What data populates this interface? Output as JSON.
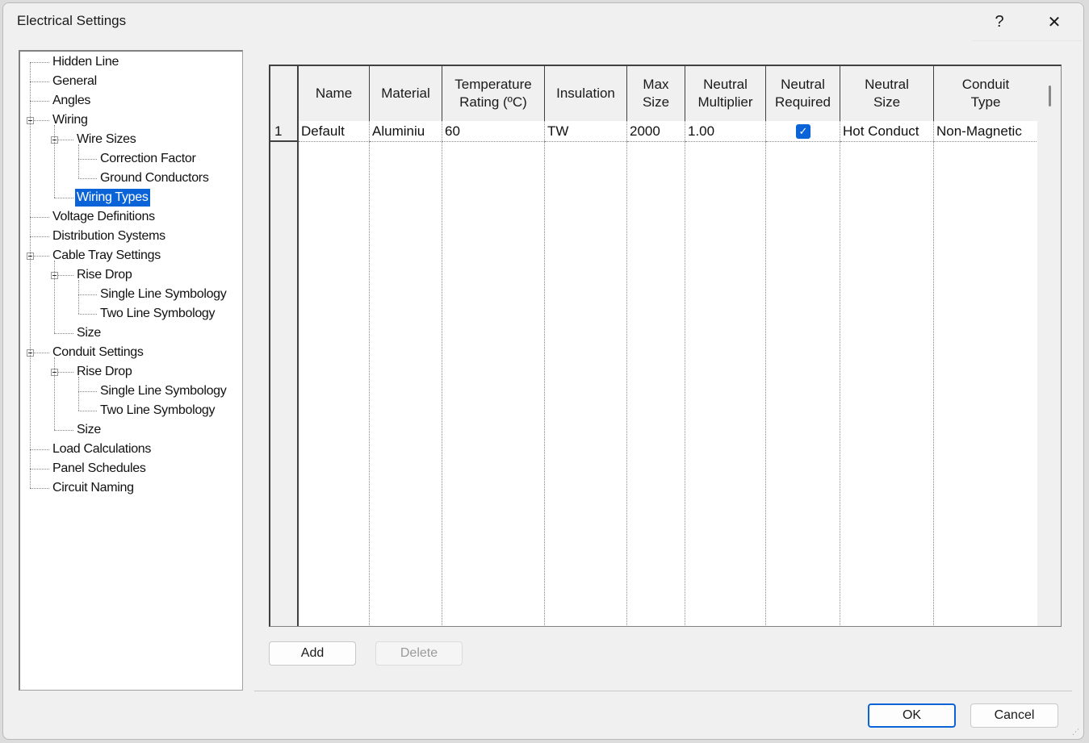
{
  "window": {
    "title": "Electrical Settings",
    "help_label": "?",
    "close_label": "✕"
  },
  "tree": {
    "items": [
      {
        "label": "Hidden Line",
        "level": 0,
        "expandable": false
      },
      {
        "label": "General",
        "level": 0,
        "expandable": false
      },
      {
        "label": "Angles",
        "level": 0,
        "expandable": false
      },
      {
        "label": "Wiring",
        "level": 0,
        "expandable": true
      },
      {
        "label": "Wire Sizes",
        "level": 1,
        "expandable": true
      },
      {
        "label": "Correction Factor",
        "level": 2,
        "expandable": false
      },
      {
        "label": "Ground Conductors",
        "level": 2,
        "expandable": false
      },
      {
        "label": "Wiring Types",
        "level": 1,
        "expandable": false,
        "selected": true
      },
      {
        "label": "Voltage Definitions",
        "level": 0,
        "expandable": false
      },
      {
        "label": "Distribution Systems",
        "level": 0,
        "expandable": false
      },
      {
        "label": "Cable Tray Settings",
        "level": 0,
        "expandable": true
      },
      {
        "label": "Rise Drop",
        "level": 1,
        "expandable": true
      },
      {
        "label": "Single Line Symbology",
        "level": 2,
        "expandable": false
      },
      {
        "label": "Two Line Symbology",
        "level": 2,
        "expandable": false
      },
      {
        "label": "Size",
        "level": 1,
        "expandable": false
      },
      {
        "label": "Conduit Settings",
        "level": 0,
        "expandable": true
      },
      {
        "label": "Rise Drop",
        "level": 1,
        "expandable": true
      },
      {
        "label": "Single Line Symbology",
        "level": 2,
        "expandable": false
      },
      {
        "label": "Two Line Symbology",
        "level": 2,
        "expandable": false
      },
      {
        "label": "Size",
        "level": 1,
        "expandable": false
      },
      {
        "label": "Load Calculations",
        "level": 0,
        "expandable": false
      },
      {
        "label": "Panel Schedules",
        "level": 0,
        "expandable": false
      },
      {
        "label": "Circuit Naming",
        "level": 0,
        "expandable": false
      }
    ]
  },
  "table": {
    "columns": [
      "Name",
      "Material",
      "Temperature\nRating (ºC)",
      "Insulation",
      "Max\nSize",
      "Neutral\nMultiplier",
      "Neutral\nRequired",
      "Neutral\nSize",
      "Conduit\nType"
    ],
    "rows": [
      {
        "index": "1",
        "cells": [
          "Default",
          "Aluminiu",
          "60",
          "TW",
          "2000",
          "1.00",
          "",
          "Hot Conduct",
          "Non-Magnetic"
        ],
        "neutral_required": true
      }
    ]
  },
  "buttons": {
    "add": "Add",
    "delete": "Delete",
    "ok": "OK",
    "cancel": "Cancel"
  },
  "colors": {
    "accent": "#0a64d8"
  }
}
